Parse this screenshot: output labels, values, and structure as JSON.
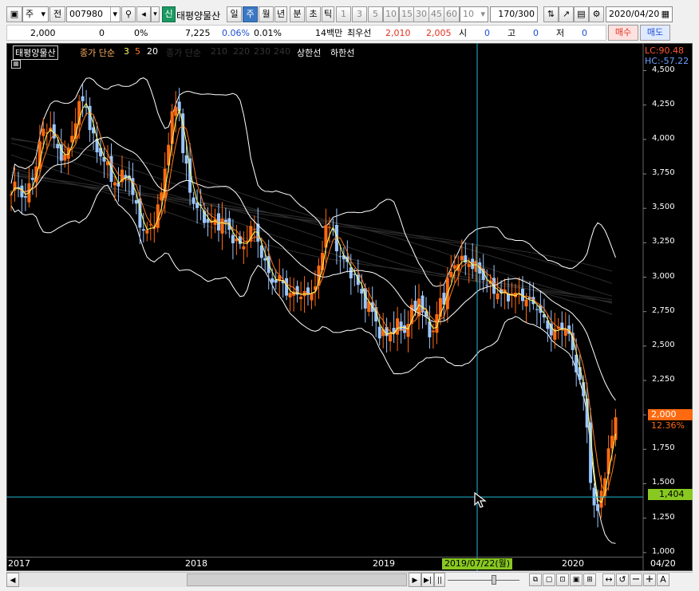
{
  "toolbar": {
    "market_type": "주",
    "prev_label": "전",
    "code": "007980",
    "badge_new": "신",
    "stock_name": "태평양물산",
    "periods": [
      "일",
      "주",
      "월",
      "년",
      "분",
      "초",
      "틱"
    ],
    "selected_period": "주",
    "intervals": [
      "1",
      "3",
      "5",
      "10",
      "15",
      "30",
      "45",
      "60"
    ],
    "interval_select": "10",
    "count": "170",
    "count_total": "/300",
    "date": "2020/04/20"
  },
  "quote": {
    "price": "2,000",
    "change": "0",
    "change_pct": "0%",
    "volume": "7,225",
    "vol_pct": "0.06%",
    "turnover_pct": "0.01%",
    "amount_label": "14백만",
    "best_label": "최우선",
    "ask": "2,010",
    "bid": "2,005",
    "open_label": "시",
    "open_val": "0",
    "high_label": "고",
    "high_val": "0",
    "low_label": "저",
    "low_val": "0",
    "buy_label": "매수",
    "sell_label": "매도"
  },
  "chart_header": {
    "name_box": "태평양물산",
    "ma_label": "종가 단순",
    "ma_periods": [
      "3",
      "5",
      "20"
    ],
    "ma2_label": "종가 단순",
    "ma2_periods": [
      "210",
      "220",
      "230",
      "240"
    ],
    "upper_limit": "상한선",
    "lower_limit": "하한선",
    "lc": "LC:90.48",
    "hc": "HC:-57.22"
  },
  "price_labels": {
    "current": "2,000",
    "current_pct": "12.36%",
    "cursor": "1,404",
    "crosshair_date": "2019/07/22(월)",
    "last_axis": "04/20"
  },
  "colors": {
    "up": "#ff6a10",
    "down": "#9cc6ff",
    "ma3": "#ffff66",
    "ma5": "#ff7a20",
    "ma20": "#ffffff",
    "crosshair": "#22b6d6",
    "current_badge": "#ff6a10",
    "cursor_badge": "#88c820"
  },
  "chart_data": {
    "type": "candlestick",
    "y_ticks": [
      "4,500",
      "4,250",
      "4,000",
      "3,750",
      "3,500",
      "3,250",
      "3,000",
      "2,750",
      "2,500",
      "2,250",
      "2,000",
      "1,750",
      "1,500",
      "1,250",
      "1,000"
    ],
    "x_labels": [
      "2017",
      "2018",
      "2019",
      "2020"
    ],
    "ylim": [
      970,
      4700
    ],
    "close_path": [
      3600,
      3680,
      3620,
      3560,
      3700,
      3800,
      4000,
      4100,
      4080,
      3950,
      3900,
      3860,
      3960,
      4150,
      4250,
      4300,
      4100,
      3950,
      3900,
      3850,
      3750,
      3700,
      3650,
      3800,
      3700,
      3550,
      3450,
      3300,
      3350,
      3400,
      3500,
      3700,
      4000,
      4200,
      4300,
      3900,
      3700,
      3550,
      3500,
      3450,
      3400,
      3400,
      3380,
      3420,
      3350,
      3300,
      3250,
      3200,
      3300,
      3350,
      3320,
      3150,
      3050,
      3000,
      2950,
      3000,
      2900,
      2850,
      2900,
      2880,
      2850,
      2900,
      2950,
      3100,
      3400,
      3350,
      3250,
      3150,
      3100,
      3050,
      3000,
      2880,
      2830,
      2780,
      2700,
      2600,
      2560,
      2600,
      2630,
      2650,
      2600,
      2700,
      2780,
      2850,
      2700,
      2620,
      2600,
      2800,
      2850,
      3000,
      3050,
      3150,
      3100,
      3100,
      3100,
      3050,
      3000,
      2950,
      2900,
      2900,
      2880,
      2850,
      2900,
      2850,
      2870,
      2830,
      2800,
      2800,
      2700,
      2650,
      2600,
      2600,
      2650,
      2630,
      2500,
      2350,
      2200,
      2000,
      1500,
      1200,
      1450,
      1600,
      1800,
      2000
    ],
    "series": [
      {
        "name": "3",
        "period": 3
      },
      {
        "name": "5",
        "period": 5
      },
      {
        "name": "20",
        "period": 20
      }
    ]
  }
}
